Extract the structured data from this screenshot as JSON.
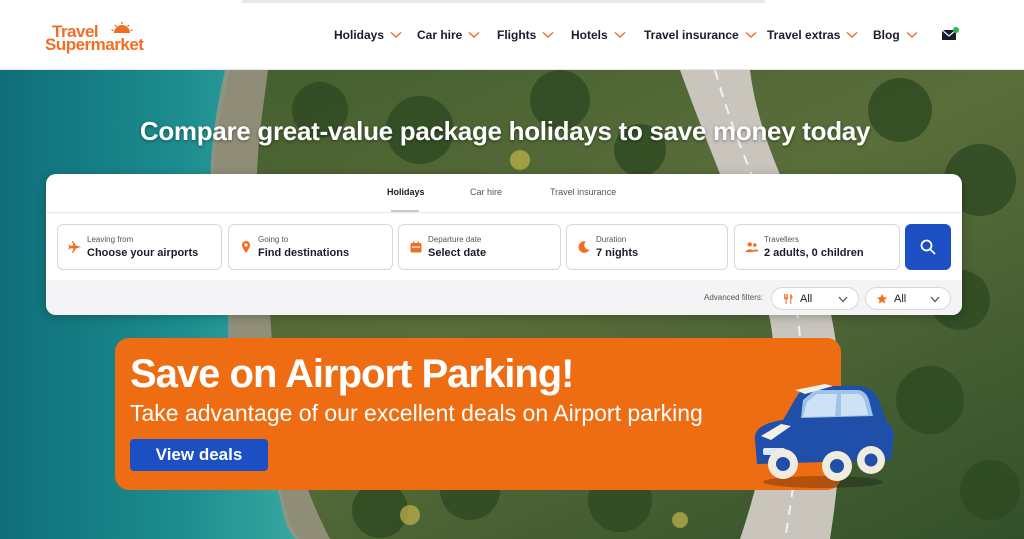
{
  "brand": {
    "line1": "Travel",
    "line2": "Supermarket",
    "color": "#f26f21"
  },
  "nav": {
    "items": [
      {
        "label": "Holidays"
      },
      {
        "label": "Car hire"
      },
      {
        "label": "Flights"
      },
      {
        "label": "Hotels"
      },
      {
        "label": "Travel insurance"
      },
      {
        "label": "Travel extras"
      },
      {
        "label": "Blog"
      }
    ],
    "mail_icon": "envelope-icon"
  },
  "hero": {
    "title": "Compare great-value package holidays to save money today"
  },
  "search": {
    "tabs": [
      {
        "label": "Holidays",
        "active": true
      },
      {
        "label": "Car hire",
        "active": false
      },
      {
        "label": "Travel insurance",
        "active": false
      }
    ],
    "fields": [
      {
        "label": "Leaving from",
        "value": "Choose your airports",
        "icon": "plane-icon"
      },
      {
        "label": "Going to",
        "value": "Find destinations",
        "icon": "location-pin-icon"
      },
      {
        "label": "Departure date",
        "value": "Select date",
        "icon": "calendar-icon"
      },
      {
        "label": "Duration",
        "value": "7 nights",
        "icon": "moon-icon"
      },
      {
        "label": "Travellers",
        "value": "2 adults, 0 children",
        "icon": "people-icon"
      }
    ],
    "search_icon": "search-icon",
    "advanced_filters_label": "Advanced filters:",
    "filters": [
      {
        "value": "All",
        "icon": "dining-icon"
      },
      {
        "value": "All",
        "icon": "star-icon"
      }
    ]
  },
  "promo": {
    "title": "Save on Airport Parking!",
    "subtitle": "Take advantage of our excellent deals on Airport parking",
    "button": "View deals"
  },
  "colors": {
    "brand_orange": "#f26f21",
    "promo_orange": "#ee6d12",
    "primary_blue": "#1d4fc4",
    "text_dark": "#1b1b2b"
  }
}
